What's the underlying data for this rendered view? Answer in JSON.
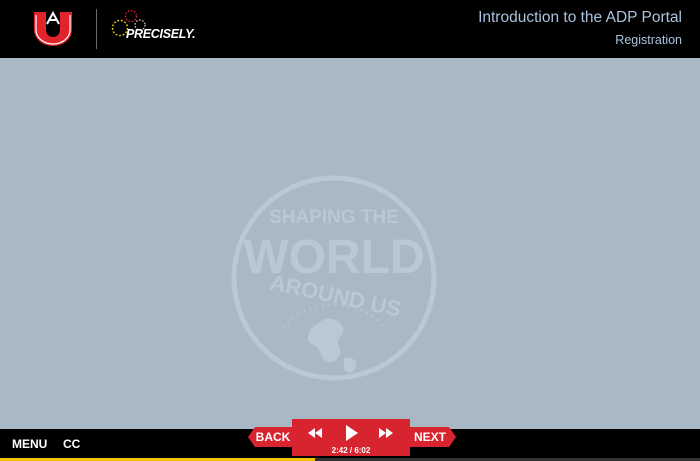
{
  "header": {
    "course_title": "Introduction to the ADP Portal",
    "section": "Registration",
    "brand_logo_icon": "university-a-logo-icon",
    "partner_logo_icon": "precisely-logo-icon",
    "partner_name": "PRECISELY."
  },
  "content": {
    "watermark_lines": [
      "SHAPING THE",
      "WORLD",
      "AROUND US"
    ]
  },
  "footer": {
    "menu_label": "MENU",
    "cc_label": "CC",
    "back_label": "BACK",
    "next_label": "NEXT",
    "time": "2:42 / 6:02",
    "progress": 0.45
  },
  "colors": {
    "accent": "#d8242e",
    "background": "#a8b9c5",
    "title": "#a9c2de",
    "progress": "#f2c200"
  }
}
